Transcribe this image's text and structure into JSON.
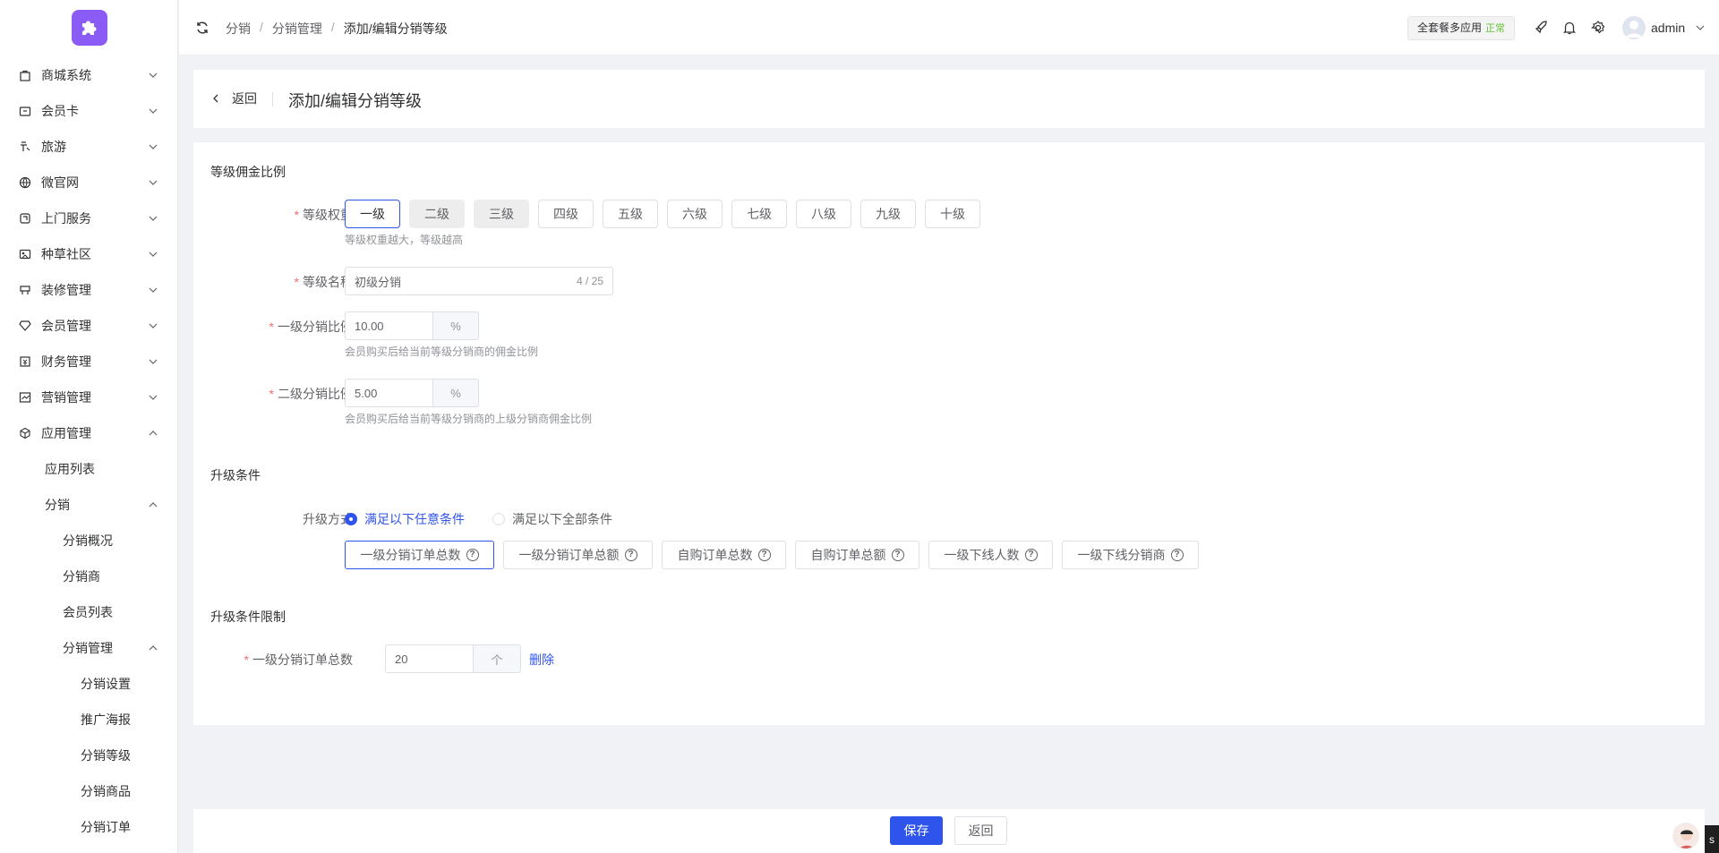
{
  "sidebar": {
    "items": [
      {
        "label": "商城系统",
        "icon": "bag-icon"
      },
      {
        "label": "会员卡",
        "icon": "card-icon"
      },
      {
        "label": "旅游",
        "icon": "travel-icon"
      },
      {
        "label": "微官网",
        "icon": "globe-icon"
      },
      {
        "label": "上门服务",
        "icon": "service-icon"
      },
      {
        "label": "种草社区",
        "icon": "community-icon"
      },
      {
        "label": "装修管理",
        "icon": "decor-icon"
      },
      {
        "label": "会员管理",
        "icon": "diamond-icon"
      },
      {
        "label": "财务管理",
        "icon": "finance-icon"
      },
      {
        "label": "营销管理",
        "icon": "chart-icon"
      },
      {
        "label": "应用管理",
        "icon": "cube-icon"
      }
    ],
    "app_sub": {
      "app_list": "应用列表",
      "fenxiao": "分销",
      "fenxiao_sub": [
        "分销概况",
        "分销商",
        "会员列表"
      ],
      "fenxiao_manage": "分销管理",
      "manage_sub": [
        "分销设置",
        "推广海报",
        "分销等级",
        "分销商品",
        "分销订单"
      ]
    }
  },
  "header": {
    "breadcrumb": [
      "分销",
      "分销管理",
      "添加/编辑分销等级"
    ],
    "plan": "全套餐多应用",
    "plan_status": "正常",
    "user": "admin"
  },
  "page_head": {
    "back": "返回",
    "title": "添加/编辑分销等级"
  },
  "form": {
    "section1": "等级佣金比例",
    "weight_label": "等级权重",
    "levels": [
      "一级",
      "二级",
      "三级",
      "四级",
      "五级",
      "六级",
      "七级",
      "八级",
      "九级",
      "十级"
    ],
    "weight_hint": "等级权重越大，等级越高",
    "name_label": "等级名称",
    "name_value": "初级分销",
    "name_count": "4 / 25",
    "ratio1_label": "一级分销比例",
    "ratio1_value": "10.00",
    "ratio1_unit": "%",
    "ratio1_hint": "会员购买后给当前等级分销商的佣金比例",
    "ratio2_label": "二级分销比例",
    "ratio2_value": "5.00",
    "ratio2_unit": "%",
    "ratio2_hint": "会员购买后给当前等级分销商的上级分销商佣金比例",
    "section2": "升级条件",
    "upgrade_label": "升级方式",
    "radio_any": "满足以下任意条件",
    "radio_all": "满足以下全部条件",
    "conditions": [
      "一级分销订单总数",
      "一级分销订单总额",
      "自购订单总数",
      "自购订单总额",
      "一级下线人数",
      "一级下线分销商"
    ],
    "section3": "升级条件限制",
    "limit_label": "一级分销订单总数",
    "limit_value": "20",
    "limit_unit": "个",
    "limit_delete": "删除"
  },
  "actions": {
    "save": "保存",
    "back": "返回"
  },
  "corner_text": "s",
  "colors": {
    "primary": "#2f54eb",
    "logo": "#8a5cf5",
    "required": "#f56c6c",
    "status_ok": "#67c23a"
  }
}
